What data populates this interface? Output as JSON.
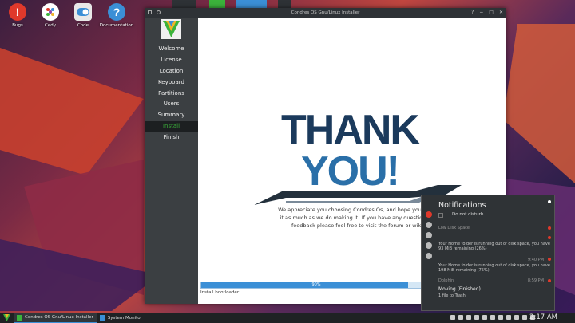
{
  "desktop": {
    "icons": [
      {
        "label": "Bugs",
        "glyph": "!",
        "color": "#e0392b"
      },
      {
        "label": "Cedy",
        "glyph": "",
        "color": "#ffffff"
      },
      {
        "label": "Code",
        "glyph": "",
        "color": "#e8e8e8"
      },
      {
        "label": "Documentation",
        "glyph": "?",
        "color": "#3b8fd6"
      }
    ]
  },
  "window": {
    "title": "Condres OS Gnu/Linux Installer"
  },
  "sidebar": {
    "items": [
      {
        "label": "Welcome"
      },
      {
        "label": "License"
      },
      {
        "label": "Location"
      },
      {
        "label": "Keyboard"
      },
      {
        "label": "Partitions"
      },
      {
        "label": "Users"
      },
      {
        "label": "Summary"
      },
      {
        "label": "Install",
        "active": true
      },
      {
        "label": "Finish"
      }
    ]
  },
  "content": {
    "thank": "THANK",
    "you": "YOU!",
    "message": "We appreciate you choosing Condres Os, and hope you enjoy it as much as we do making it! If you have any questions or feedback please feel free to visit the forum or wiki.",
    "progress": 90,
    "progress_label": "90%",
    "status": "Install bootloader"
  },
  "notifications": {
    "title": "Notifications",
    "dnd_label": "Do not disturb",
    "items": [
      {
        "header": "Low Disk Space",
        "time": "",
        "text": ""
      },
      {
        "header": "",
        "time": "",
        "text": "Your Home folder is running out of disk space, you have 93 MiB remaining (26%)"
      },
      {
        "header": "",
        "time": "9:40 PM",
        "text": "Your Home folder is running out of disk space, you have 198 MiB remaining (75%)"
      },
      {
        "header": "Dolphin",
        "time": "8:59 PM",
        "title": "Moving (Finished)",
        "text": "1 file to Trash"
      }
    ]
  },
  "taskbar": {
    "tasks": [
      {
        "label": "Condres OS Gnu/Linux Installer",
        "active": true
      },
      {
        "label": "System Monitor",
        "active": false
      }
    ],
    "clock": "2:17 AM"
  },
  "colors": {
    "accent": "#3b8fd6",
    "active_nav": "#3bb33b",
    "thank_navy": "#1b3a5c",
    "you_blue": "#2a6fa8"
  }
}
